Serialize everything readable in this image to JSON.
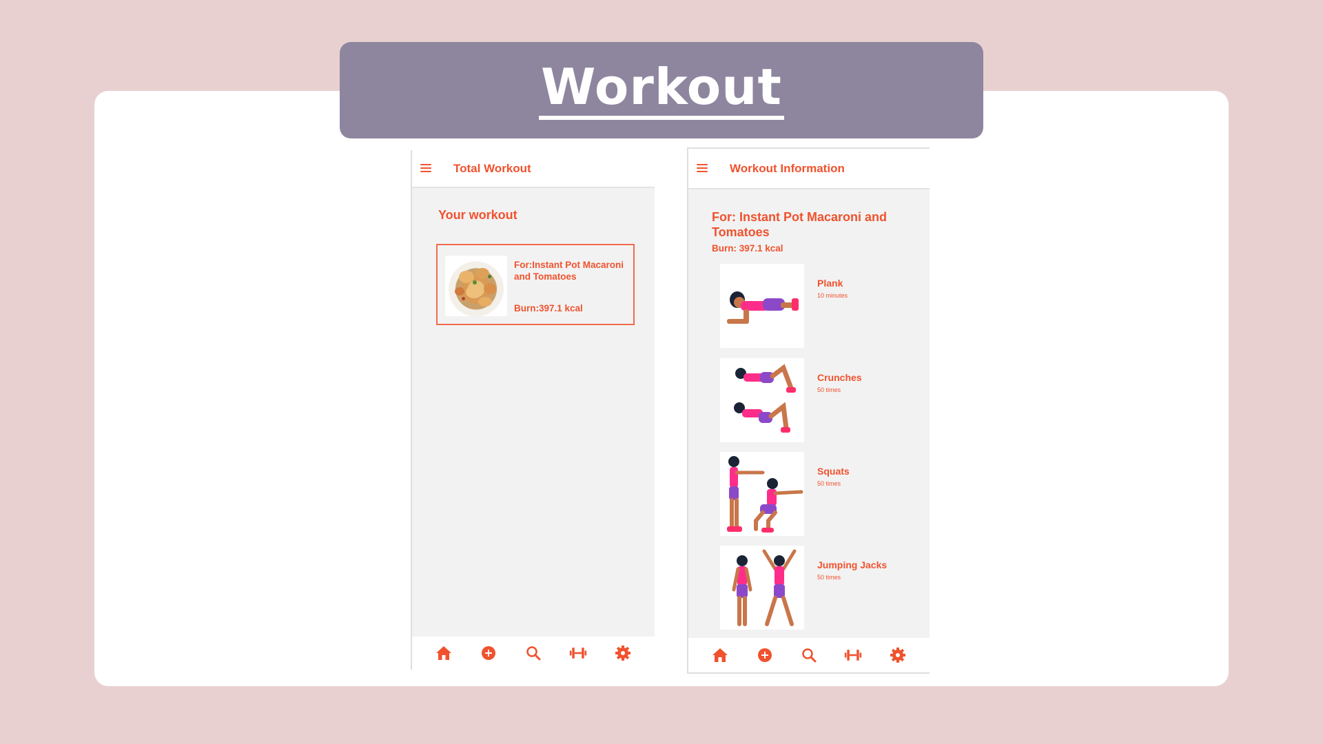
{
  "banner": {
    "title": "Workout"
  },
  "left_screen": {
    "header_title": "Total Workout",
    "section_title": "Your workout",
    "meal_card": {
      "title": "For:Instant Pot Macaroni and Tomatoes",
      "burn": "Burn:397.1 kcal"
    }
  },
  "right_screen": {
    "header_title": "Workout Information",
    "for_title": "For: Instant Pot Macaroni and Tomatoes",
    "burn": "Burn: 397.1 kcal",
    "exercises": [
      {
        "name": "Plank",
        "detail": "10  minutes"
      },
      {
        "name": "Crunches",
        "detail": "50 times"
      },
      {
        "name": "Squats",
        "detail": "50 times"
      },
      {
        "name": "Jumping Jacks",
        "detail": "50 times"
      }
    ]
  },
  "bottom_nav_icons": [
    "home-icon",
    "add-icon",
    "search-icon",
    "dumbbell-icon",
    "settings-icon"
  ],
  "colors": {
    "accent": "#f0522e",
    "banner": "#8e869e",
    "background": "#e8d0d1"
  }
}
